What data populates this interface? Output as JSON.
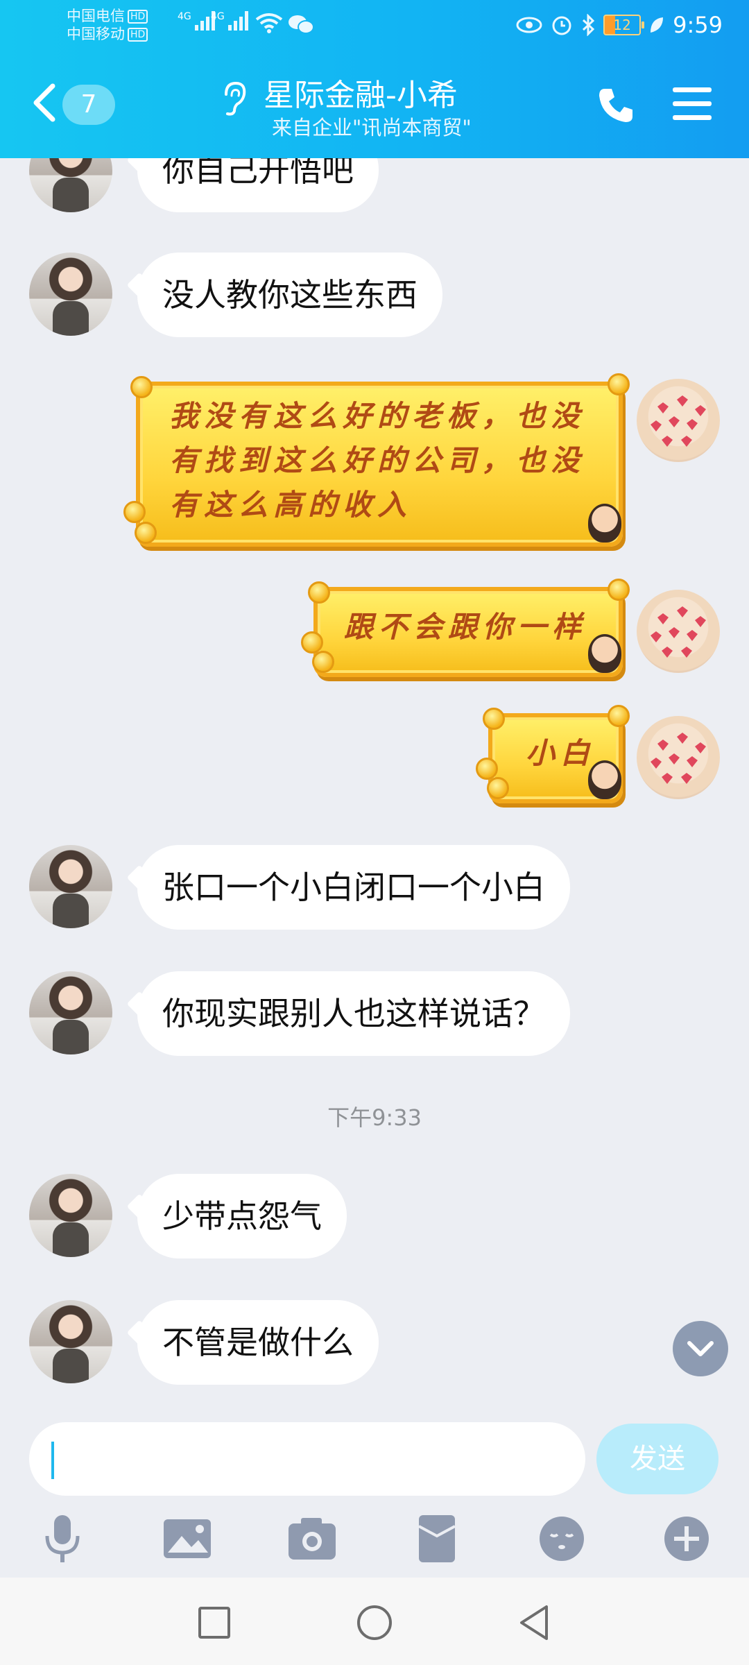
{
  "status_bar": {
    "carrier1": "中国电信",
    "carrier2": "中国移动",
    "hd": "HD",
    "network1": "4G",
    "network2": "4G",
    "battery": "12",
    "time": "9:59"
  },
  "header": {
    "unread_count": "7",
    "title": "星际金融-小希",
    "subtitle": "来自企业\"讯尚本商贸\""
  },
  "messages": [
    {
      "side": "left",
      "text": "你自己开悟吧"
    },
    {
      "side": "left",
      "text": "没人教你这些东西"
    },
    {
      "side": "right",
      "lines": [
        "我没有这么好的老板，也没",
        "有找到这么好的公司，也没",
        "有这么高的收入"
      ]
    },
    {
      "side": "right",
      "text": "跟不会跟你一样"
    },
    {
      "side": "right",
      "text": "小白"
    },
    {
      "side": "left",
      "text": "张口一个小白闭口一个小白"
    },
    {
      "side": "left",
      "text": "你现实跟别人也这样说话？"
    },
    {
      "timestamp": "下午9:33"
    },
    {
      "side": "left",
      "text": "少带点怨气"
    },
    {
      "side": "left",
      "text": "不管是做什么"
    }
  ],
  "input": {
    "value": "",
    "send_label": "发送"
  },
  "colors": {
    "header_start": "#16c6f2",
    "header_end": "#139df1",
    "background": "#eceef3",
    "gold_bubble": "#ffd53c",
    "send_disabled": "#b8ecfb"
  },
  "icons": [
    "back-icon",
    "ear-icon",
    "phone-icon",
    "menu-icon",
    "microphone-icon",
    "image-icon",
    "camera-icon",
    "red-packet-icon",
    "emoji-icon",
    "plus-icon",
    "chevron-down-icon",
    "nav-square-icon",
    "nav-circle-icon",
    "nav-triangle-icon"
  ]
}
